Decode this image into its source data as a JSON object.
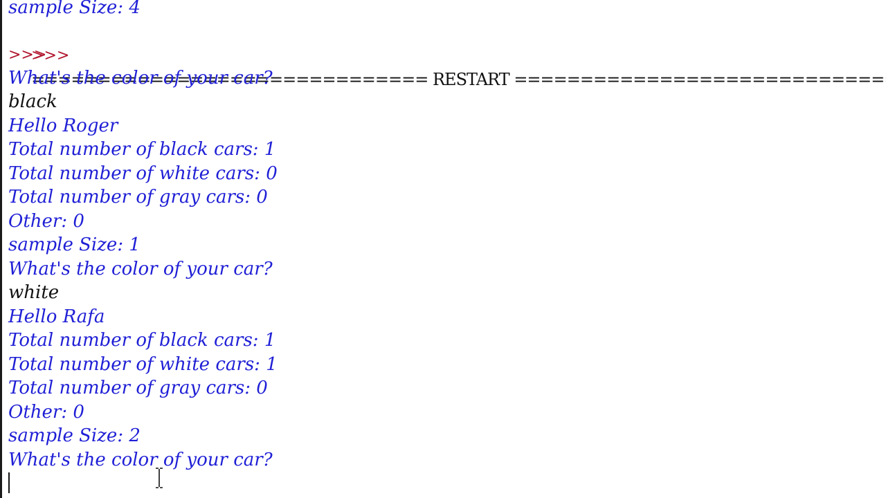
{
  "window": {
    "colors": {
      "output": "#1f1fd6",
      "input": "#111111",
      "prompt": "#b0142d"
    }
  },
  "shell": {
    "lines": [
      {
        "kind": "output",
        "text": "sample Size: 4"
      },
      {
        "kind": "restart",
        "prompt": ">>>",
        "text": "============================== RESTART ================================"
      },
      {
        "kind": "prompt",
        "text": ">>>"
      },
      {
        "kind": "output",
        "text": "What's the color of your car?"
      },
      {
        "kind": "input",
        "text": "black"
      },
      {
        "kind": "output",
        "text": "Hello Roger"
      },
      {
        "kind": "output",
        "text": "Total number of black cars: 1"
      },
      {
        "kind": "output",
        "text": "Total number of white cars: 0"
      },
      {
        "kind": "output",
        "text": "Total number of gray cars: 0"
      },
      {
        "kind": "output",
        "text": "Other: 0"
      },
      {
        "kind": "output",
        "text": "sample Size: 1"
      },
      {
        "kind": "output",
        "text": "What's the color of your car?"
      },
      {
        "kind": "input",
        "text": "white"
      },
      {
        "kind": "output",
        "text": "Hello Rafa"
      },
      {
        "kind": "output",
        "text": "Total number of black cars: 1"
      },
      {
        "kind": "output",
        "text": "Total number of white cars: 1"
      },
      {
        "kind": "output",
        "text": "Total number of gray cars: 0"
      },
      {
        "kind": "output",
        "text": "Other: 0"
      },
      {
        "kind": "output",
        "text": "sample Size: 2"
      },
      {
        "kind": "output",
        "text": "What's the color of your car?"
      }
    ],
    "cursor": {
      "icon": "text-cursor-icon",
      "pointer_icon": "i-beam-icon"
    }
  }
}
